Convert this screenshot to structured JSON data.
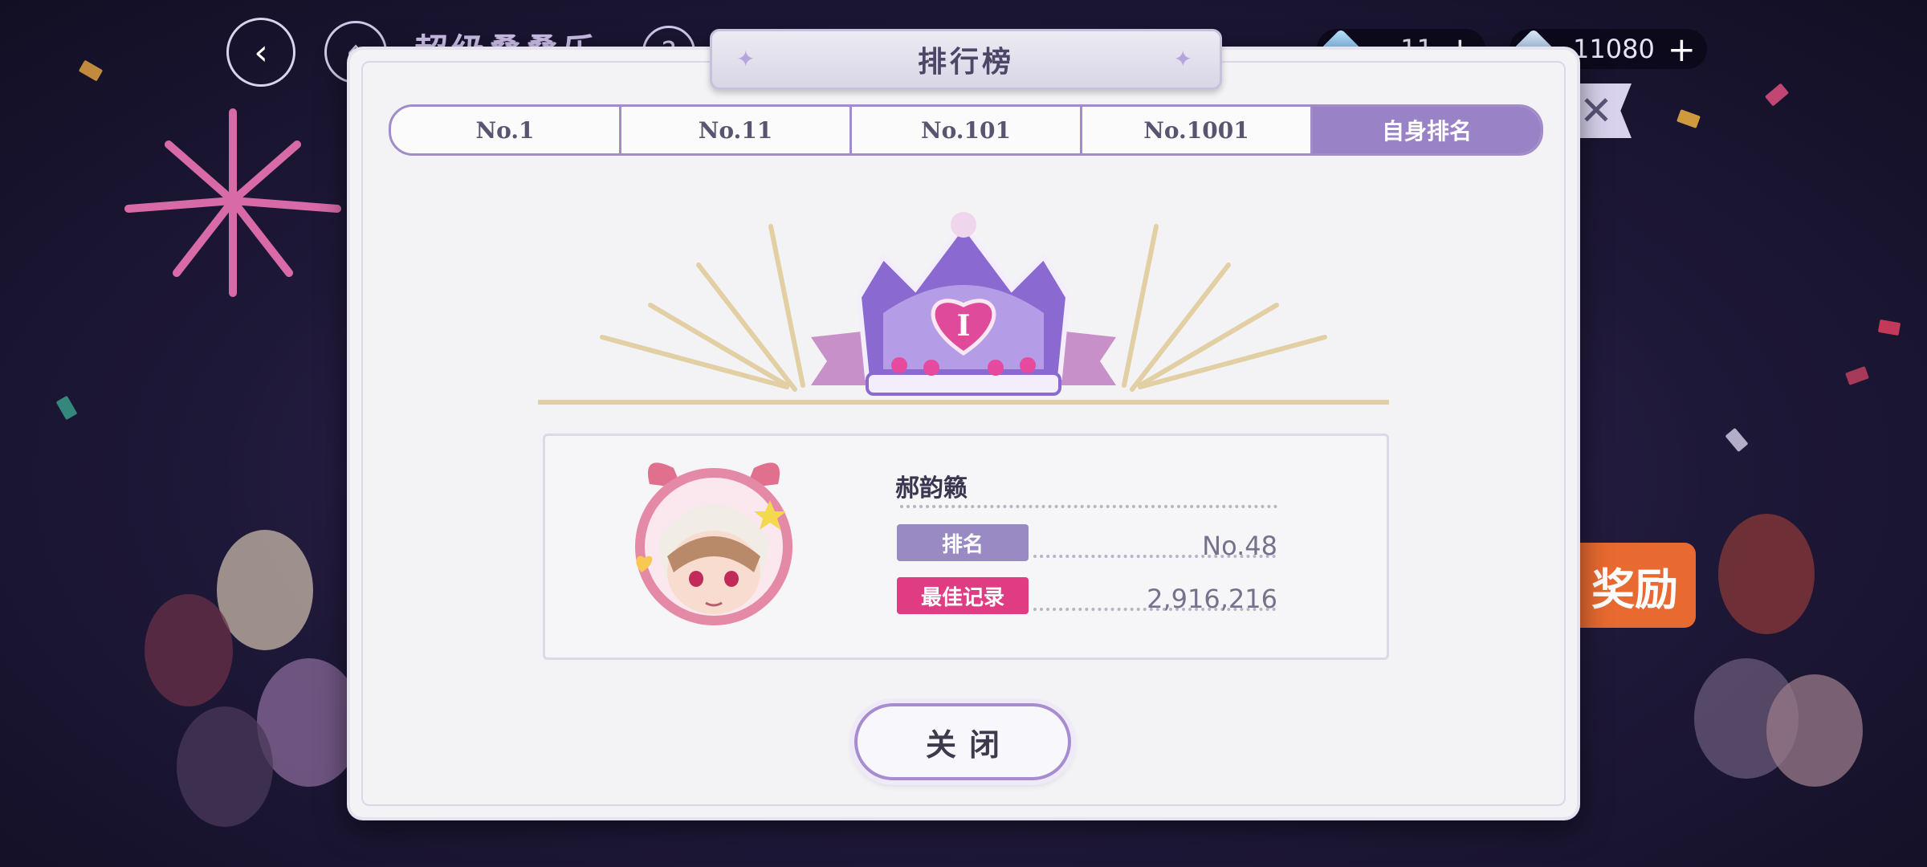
{
  "hud": {
    "back_icon": "back-arrow-icon",
    "home_icon": "home-icon",
    "event_title": "超级叠叠乐",
    "help_label": "?",
    "currencies": [
      {
        "icon": "gem-icon",
        "value": "11",
        "plus": "+"
      },
      {
        "icon": "crystal-icon",
        "value": "11080",
        "plus": "+"
      }
    ],
    "close_symbol": "✕",
    "reward_label": "奖励"
  },
  "modal": {
    "title": "排行榜",
    "title_decoration": "✦",
    "tabs": [
      {
        "label": "No.1",
        "active": false
      },
      {
        "label": "No.11",
        "active": false
      },
      {
        "label": "No.101",
        "active": false
      },
      {
        "label": "No.1001",
        "active": false
      },
      {
        "label": "自身排名",
        "active": true
      }
    ],
    "crown_mark": "I",
    "player": {
      "name": "郝韵籁",
      "rank_label": "排名",
      "rank_value": "No.48",
      "best_label": "最佳记录",
      "best_value": "2,916,216"
    },
    "close_button": "关闭"
  },
  "colors": {
    "accent_purple": "#9a82c6",
    "best_pink": "#e03c84",
    "reward_orange": "#e86a30",
    "modal_bg": "#f3f2f4"
  }
}
